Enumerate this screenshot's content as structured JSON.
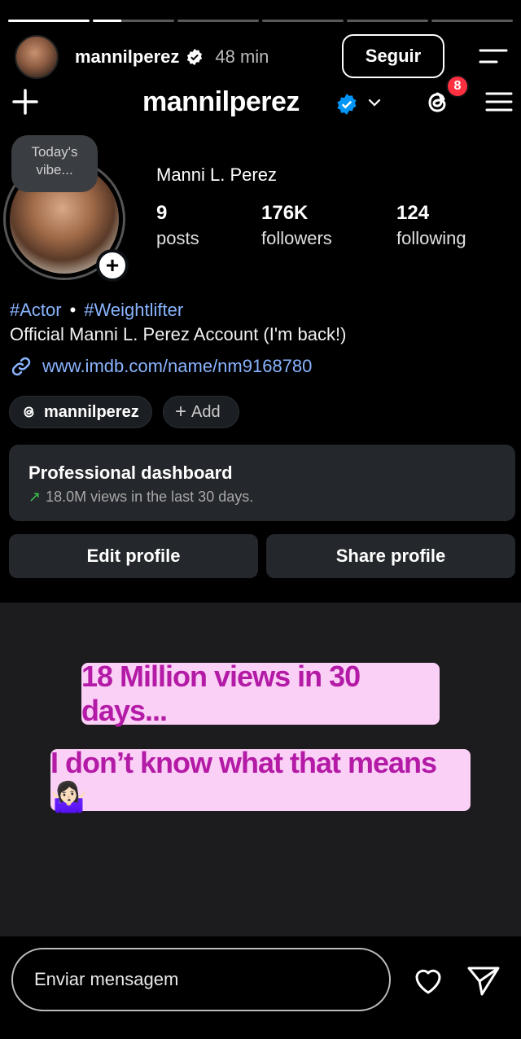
{
  "story": {
    "username": "mannilperez",
    "time": "48 min",
    "follow_label": "Seguir",
    "reply_placeholder": "Enviar mensagem",
    "captions": [
      "18 Million views in 30 days...",
      "I don’t know what that means 🤷🏻‍♀️"
    ]
  },
  "profile": {
    "handle": "mannilperez",
    "threads_badge": "8",
    "note": "Today's vibe...",
    "display_name": "Manni L. Perez",
    "stats": [
      {
        "num": "9",
        "label": "posts"
      },
      {
        "num": "176K",
        "label": "followers"
      },
      {
        "num": "124",
        "label": "following"
      }
    ],
    "tags": [
      "#Actor",
      "#Weightlifter"
    ],
    "tag_separator": "•",
    "bio": "Official Manni L. Perez Account (I'm back!)",
    "link": "www.imdb.com/name/nm9168780",
    "threads_chip": "mannilperez",
    "add_chip": "Add",
    "dashboard_title": "Professional dashboard",
    "dashboard_arrow": "↗",
    "dashboard_sub": "18.0M views in the last 30 days.",
    "edit_label": "Edit profile",
    "share_label": "Share profile"
  },
  "colors": {
    "link": "#8ab4ff",
    "badge": "#ff3040",
    "verified": "#0095f6",
    "caption_bg": "#fbd0f6",
    "caption_text": "#b31aa6"
  }
}
